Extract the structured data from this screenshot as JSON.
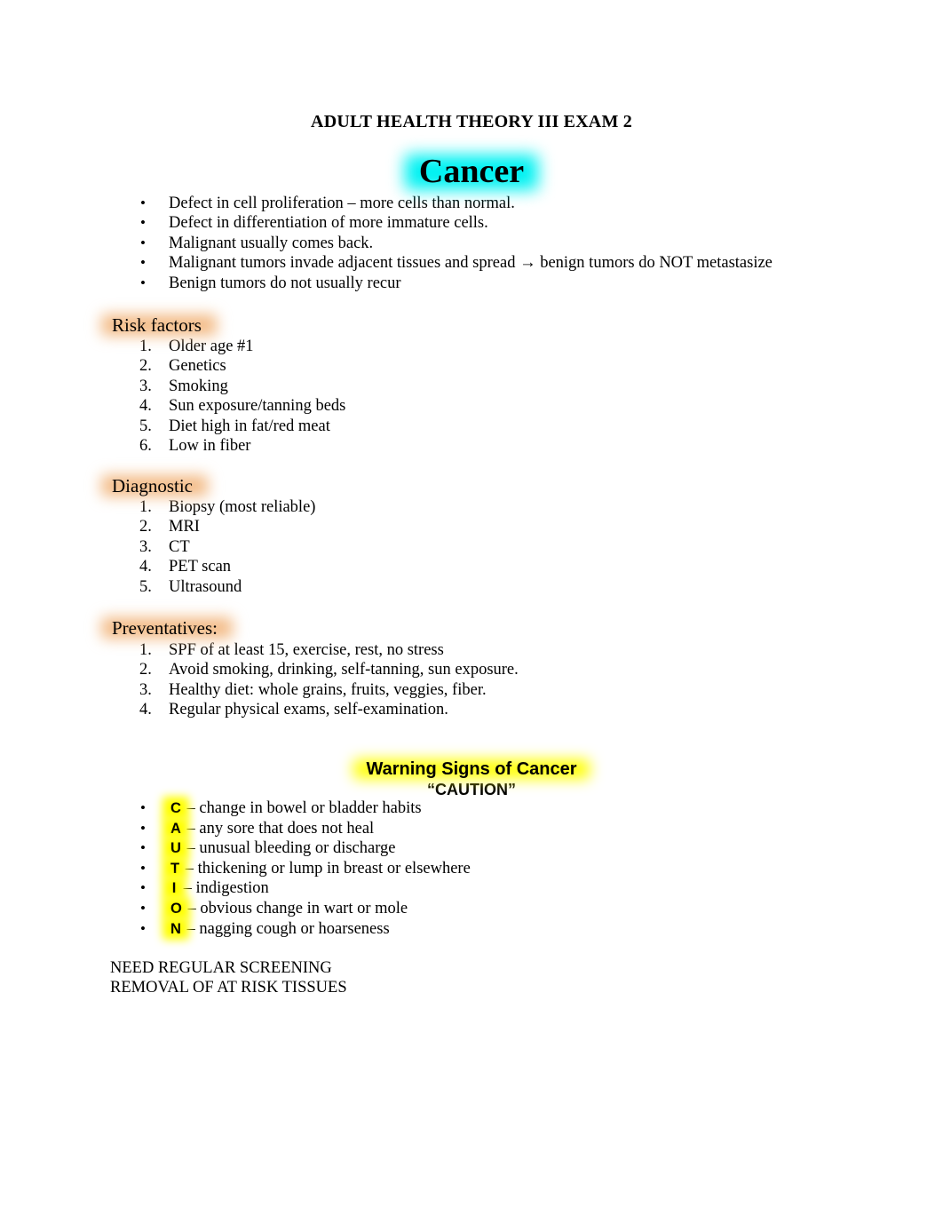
{
  "document": {
    "title": "ADULT HEALTH THEORY III EXAM 2",
    "subject_title": "Cancer"
  },
  "colors": {
    "cancer_highlight": "#00F2F2",
    "section_highlight": "#F3BB86",
    "warning_highlight": "#FFFF00",
    "text": "#000000",
    "background": "#FFFFFF"
  },
  "intro": {
    "bullet_marker": "•",
    "items": [
      "Defect in cell proliferation – more cells than normal.",
      "Defect in differentiation of more immature cells.",
      "Malignant usually comes back.",
      "Malignant tumors invade adjacent tissues and spread →  benign tumors do NOT metastasize",
      "Benign tumors do not usually recur"
    ]
  },
  "risk_factors": {
    "heading": "Risk factors",
    "markers": [
      "1.",
      "2.",
      "3.",
      "4.",
      "5.",
      "6."
    ],
    "items": [
      "Older age #1",
      "Genetics",
      "Smoking",
      "Sun exposure/tanning beds",
      "Diet high in fat/red meat",
      "Low in fiber"
    ]
  },
  "diagnostic": {
    "heading": "Diagnostic",
    "markers": [
      "1.",
      "2.",
      "3.",
      "4.",
      "5."
    ],
    "items": [
      "Biopsy (most reliable)",
      "MRI",
      "CT",
      "PET scan",
      "Ultrasound"
    ]
  },
  "preventatives": {
    "heading": "Preventatives:",
    "markers": [
      "1.",
      "2.",
      "3.",
      "4."
    ],
    "items": [
      "SPF of at least 15, exercise, rest, no stress",
      "Avoid smoking, drinking, self-tanning, sun exposure.",
      "Healthy diet: whole grains, fruits, veggies, fiber.",
      "Regular physical exams, self-examination."
    ]
  },
  "warning_signs": {
    "heading": "Warning Signs of Cancer",
    "acronym": "“CAUTION”",
    "bullet_marker": "•",
    "items": [
      {
        "letter": "C",
        "text": "– change in bowel or bladder habits"
      },
      {
        "letter": "A",
        "text": "– any sore that does not heal"
      },
      {
        "letter": "U",
        "text": "– unusual bleeding or discharge"
      },
      {
        "letter": "T",
        "text": "– thickening or lump in breast or elsewhere"
      },
      {
        "letter": "I",
        "text": "– indigestion"
      },
      {
        "letter": "O",
        "text": "– obvious change in wart or mole"
      },
      {
        "letter": "N",
        "text": "– nagging cough or hoarseness"
      }
    ]
  },
  "footer": {
    "lines": [
      "NEED REGULAR SCREENING",
      "REMOVAL OF AT RISK TISSUES"
    ]
  }
}
